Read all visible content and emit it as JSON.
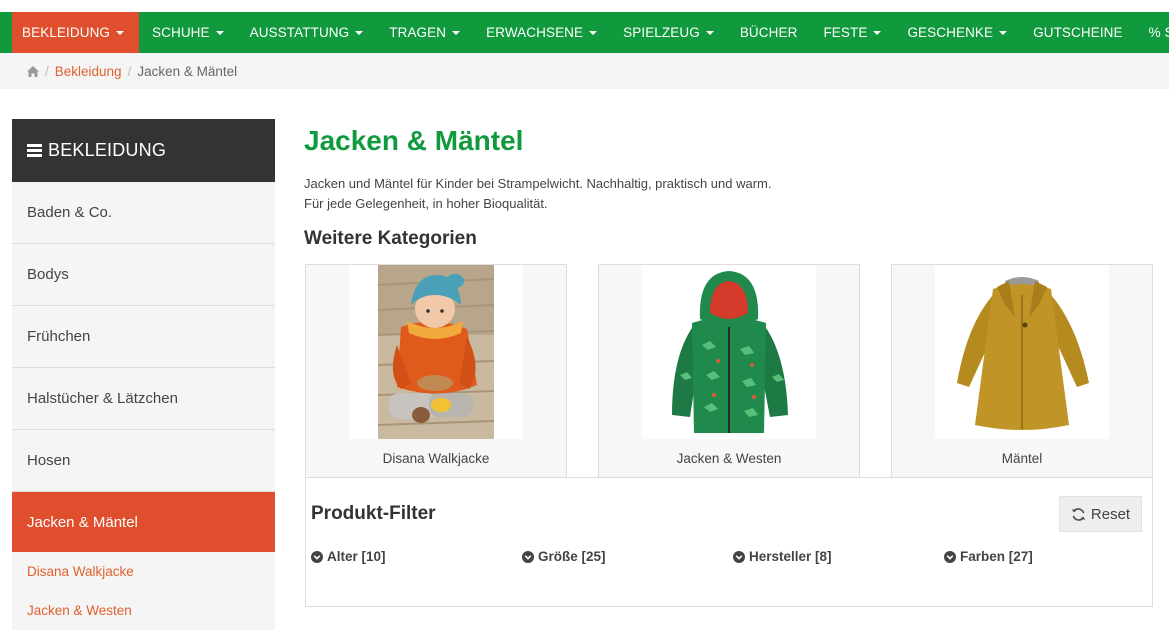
{
  "nav": {
    "items": [
      {
        "label": "BEKLEIDUNG",
        "dropdown": true,
        "active": true
      },
      {
        "label": "SCHUHE",
        "dropdown": true
      },
      {
        "label": "AUSSTATTUNG",
        "dropdown": true
      },
      {
        "label": "TRAGEN",
        "dropdown": true
      },
      {
        "label": "ERWACHSENE",
        "dropdown": true
      },
      {
        "label": "SPIELZEUG",
        "dropdown": true
      },
      {
        "label": "BÜCHER",
        "dropdown": false
      },
      {
        "label": "FESTE",
        "dropdown": true
      },
      {
        "label": "GESCHENKE",
        "dropdown": true
      },
      {
        "label": "GUTSCHEINE",
        "dropdown": false
      },
      {
        "label": "% SALE %",
        "dropdown": false
      }
    ]
  },
  "breadcrumb": {
    "home_icon": "home-icon",
    "link": "Bekleidung",
    "current": "Jacken & Mäntel"
  },
  "sidebar": {
    "header": "BEKLEIDUNG",
    "items": [
      {
        "label": "Baden & Co."
      },
      {
        "label": "Bodys"
      },
      {
        "label": "Frühchen"
      },
      {
        "label": "Halstücher & Lätzchen"
      },
      {
        "label": "Hosen"
      },
      {
        "label": "Jacken & Mäntel",
        "active": true
      }
    ],
    "subitems": [
      {
        "label": "Disana Walkjacke"
      },
      {
        "label": "Jacken & Westen"
      }
    ]
  },
  "main": {
    "title": "Jacken & Mäntel",
    "intro_line1": "Jacken und Mäntel für Kinder bei Strampelwicht. Nachhaltig, praktisch und warm.",
    "intro_line2": "Für jede Gelegenheit, in hoher Bioqualität.",
    "categories_title": "Weitere Kategorien",
    "categories": [
      {
        "label": "Disana Walkjacke",
        "image": "child-orange-wool-jacket-photo"
      },
      {
        "label": "Jacken & Westen",
        "image": "green-dino-hooded-jacket-photo"
      },
      {
        "label": "Mäntel",
        "image": "mustard-wool-coat-photo"
      }
    ]
  },
  "filter": {
    "title": "Produkt-Filter",
    "reset_label": "Reset",
    "options": [
      {
        "label": "Alter [10]"
      },
      {
        "label": "Größe [25]"
      },
      {
        "label": "Hersteller [8]"
      },
      {
        "label": "Farben [27]"
      }
    ]
  },
  "colors": {
    "brand_green": "#119a3d",
    "accent_orange": "#e04f2d",
    "link_orange": "#e0602f",
    "sidebar_dark": "#333333"
  }
}
